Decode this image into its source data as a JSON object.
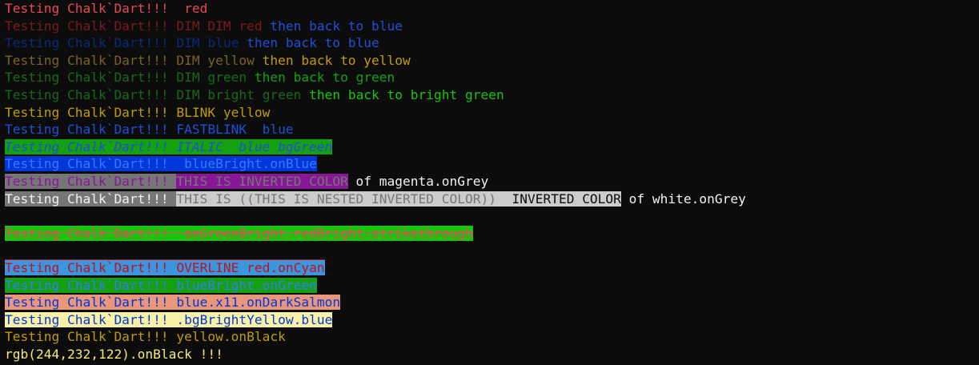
{
  "colors": {
    "background": "#0c0c0c",
    "red": "#e74856",
    "dim_red": "#7a1a22",
    "blue_bright": "#3b78ff",
    "blue": "#0037da",
    "dim_blue": "#0a2a7a",
    "yellow": "#c19c00",
    "dim_yellow": "#7a6320",
    "green": "#13a10e",
    "dim_green": "#166a16",
    "bright_green": "#16c60c",
    "magenta": "#881798",
    "grey": "#767676",
    "light_grey": "#cccccc",
    "cyan": "#3a96dd",
    "dark_salmon": "#e9967a",
    "bright_yellow_bg": "#f9f1a5",
    "white": "#f2f2f2",
    "rgb_yellow": "#f4e87a"
  },
  "terminal": {
    "lines": [
      [
        {
          "text": "Testing Chalk`Dart!!!  red",
          "fg": "#e74856"
        }
      ],
      [
        {
          "text": "Testing Chalk`Dart!!! DIM DIM red ",
          "fg": "#7a1a22"
        },
        {
          "text": "then back to blue",
          "fg": "#1f4fd8"
        }
      ],
      [
        {
          "text": "Testing Chalk`Dart!!! DIM blue ",
          "fg": "#0a2a7a"
        },
        {
          "text": "then back to blue",
          "fg": "#1f4fd8"
        }
      ],
      [
        {
          "text": "Testing Chalk`Dart!!! DIM yellow ",
          "fg": "#7a6320"
        },
        {
          "text": "then back to yellow",
          "fg": "#c19c00"
        }
      ],
      [
        {
          "text": "Testing Chalk`Dart!!! DIM green ",
          "fg": "#166a16"
        },
        {
          "text": "then back to green",
          "fg": "#13a10e"
        }
      ],
      [
        {
          "text": "Testing Chalk`Dart!!! DIM bright green ",
          "fg": "#166a16"
        },
        {
          "text": "then back to bright green",
          "fg": "#16c60c"
        }
      ],
      [
        {
          "text": "Testing Chalk`Dart!!! BLINK yellow",
          "fg": "#c19c00"
        }
      ],
      [
        {
          "text": "Testing Chalk`Dart!!! FASTBLINK  blue",
          "fg": "#1f4fd8"
        }
      ],
      [
        {
          "text": "Testing Chalk`Dart!!! ITALIC  blue bgGreen",
          "fg": "#1f4fd8",
          "bg": "#13a10e",
          "style": "italic"
        }
      ],
      [
        {
          "text": "Testing Chalk`Dart!!!  blueBright.onBlue",
          "fg": "#3b78ff",
          "bg": "#0037da"
        }
      ],
      [
        {
          "text": "Testing Chalk`Dart!!! ",
          "fg": "#881798",
          "bg": "#767676"
        },
        {
          "text": "THIS IS INVERTED COLOR",
          "fg": "#767676",
          "bg": "#881798"
        },
        {
          "text": " of magenta.onGrey",
          "fg": "#f2f2f2"
        }
      ],
      [
        {
          "text": "Testing Chalk`Dart!!! ",
          "fg": "#f2f2f2",
          "bg": "#767676"
        },
        {
          "text": "THIS IS ((THIS IS NESTED INVERTED COLOR)) ",
          "fg": "#767676",
          "bg": "#cccccc"
        },
        {
          "text": " INVERTED COLOR",
          "fg": "#0c0c0c",
          "bg": "#cccccc"
        },
        {
          "text": " of white.onGrey",
          "fg": "#f2f2f2"
        }
      ],
      [
        {
          "text": " ",
          "fg": "#cccccc"
        }
      ],
      [
        {
          "text": "Testing Chalk`Dart!!!  onGreenBright.redBright.strikethrough",
          "fg": "#e74856",
          "bg": "#16c60c",
          "style": "strike"
        }
      ],
      [
        {
          "text": " ",
          "fg": "#cccccc"
        }
      ],
      [
        {
          "text": "Testing Chalk`Dart!!! OVERLINE red.onCyan",
          "fg": "#c50f1f",
          "bg": "#3a96dd",
          "style": "overline"
        }
      ],
      [
        {
          "text": "Testing Chalk`Dart!!! blueBright.onGreen",
          "fg": "#3b78ff",
          "bg": "#13a10e"
        }
      ],
      [
        {
          "text": "Testing Chalk`Dart!!! blue.x11.onDarkSalmon",
          "fg": "#0037da",
          "bg": "#e9967a"
        }
      ],
      [
        {
          "text": "Testing Chalk`Dart!!! .bgBrightYellow.blue",
          "fg": "#0037da",
          "bg": "#f9f1a5"
        }
      ],
      [
        {
          "text": "Testing Chalk`Dart!!! yellow.onBlack",
          "fg": "#c19c00",
          "bg": "#0c0c0c"
        }
      ],
      [
        {
          "text": "rgb(244,232,122).onBlack !!!",
          "fg": "#f4e87a",
          "bg": "#0c0c0c"
        }
      ]
    ]
  }
}
